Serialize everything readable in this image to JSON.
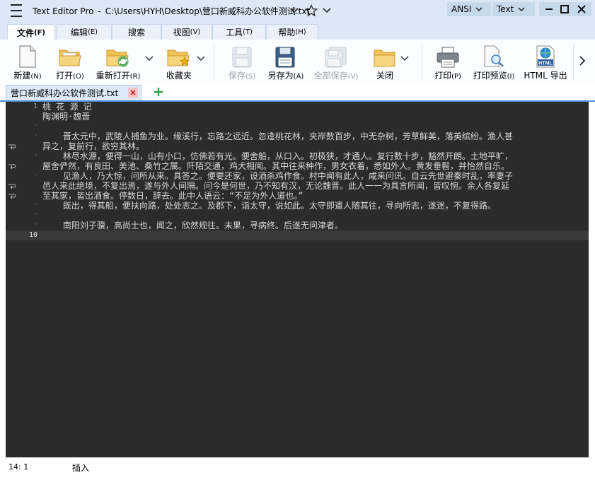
{
  "window": {
    "app_name": "Text Editor Pro",
    "separator": "-",
    "file_path": "C:\\Users\\HYH\\Desktop\\营口新威科办公软件测试.txt",
    "encoding": "ANSI",
    "syntax": "Text"
  },
  "menu_tabs": [
    {
      "label": "文件",
      "accel": "(F)"
    },
    {
      "label": "编辑",
      "accel": "(E)"
    },
    {
      "label": "搜索",
      "accel": ""
    },
    {
      "label": "视图",
      "accel": "(V)"
    },
    {
      "label": "工具",
      "accel": "(T)"
    },
    {
      "label": "帮助",
      "accel": "(H)"
    }
  ],
  "ribbon": {
    "new": {
      "label": "新建",
      "accel": "(N)"
    },
    "open": {
      "label": "打开",
      "accel": "(O)"
    },
    "reopen": {
      "label": "重新打开",
      "accel": "(R)"
    },
    "favorites": {
      "label": "收藏夹",
      "accel": ""
    },
    "save": {
      "label": "保存",
      "accel": "(S)"
    },
    "save_as": {
      "label": "另存为",
      "accel": "(A)"
    },
    "save_all": {
      "label": "全部保存",
      "accel": "(V)"
    },
    "close": {
      "label": "关闭",
      "accel": ""
    },
    "print": {
      "label": "打印",
      "accel": "(P)"
    },
    "print_preview": {
      "label": "打印预览",
      "accel": "(I)"
    },
    "html_export": {
      "label": "HTML 导出",
      "accel": ""
    },
    "html_icon_text": "HTML"
  },
  "doc_tab": {
    "name": "营口新威科办公软件测试.txt"
  },
  "editor": {
    "line_numbers": [
      "1",
      "10"
    ],
    "lines": [
      "桃 花 源 记",
      "陶渊明·魏晋",
      "",
      "    晋太元中，武陵人捕鱼为业。缘溪行，忘路之远近。忽逢桃花林，夹岸数百步，中无杂树，芳草鲜美，落英缤纷。渔人甚",
      "异之，复前行，欲穷其林。",
      "    林尽水源，便得一山，山有小口，仿佛若有光。便舍船，从口入。初极狭，才通人。复行数十步，豁然开朗。土地平旷，",
      "屋舍俨然，有良田、美池、桑竹之属。阡陌交通，鸡犬相闻。其中往来种作，男女衣着，悉如外人。黄发垂髫，并怡然自乐。",
      "    见渔人，乃大惊，问所从来。具答之。便要还家，设酒杀鸡作食。村中闻有此人，咸来问讯。自云先世避秦时乱，率妻子",
      "邑人来此绝境，不复出焉，遂与外人间隔。问今是何世，乃不知有汉，无论魏晋。此人一一为具言所闻，皆叹惋。余人各复延",
      "至其家，皆出酒食。停数日，辞去。此中人语云：“不足为外人道也。”",
      "    既出，得其船，便扶向路，处处志之。及郡下，诣太守，说如此。太守即遣人随其往，寻向所志，遂迷，不复得路。",
      "",
      "    南阳刘子骥，高尚士也，闻之，欣然规往。未果，寻病终。后遂无问津者。",
      ""
    ],
    "gutter_dot": "·"
  },
  "status": {
    "position": "14: 1",
    "mode": "插入"
  }
}
